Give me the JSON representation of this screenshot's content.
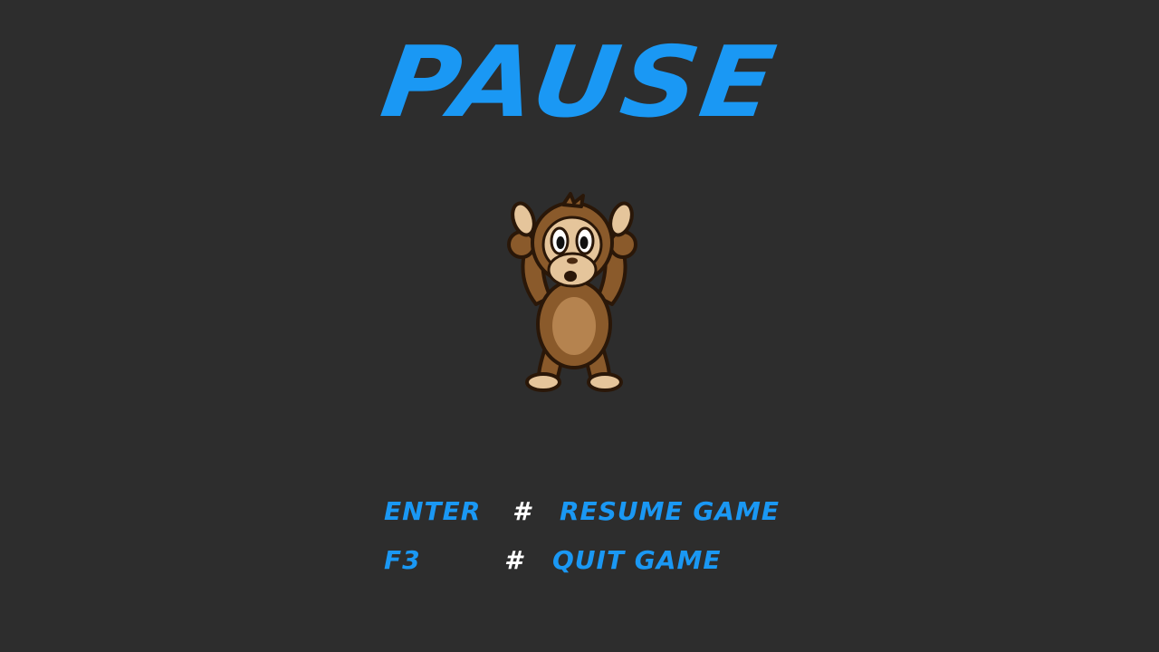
{
  "pause_menu": {
    "title": "PAUSE",
    "mascot_icon": "monkey-hands-up-icon",
    "controls": [
      {
        "key": "ENTER",
        "separator": "#",
        "action": "RESUME GAME"
      },
      {
        "key": "F3",
        "separator": "#",
        "action": "QUIT GAME"
      }
    ]
  },
  "colors": {
    "background": "#2d2d2d",
    "accent": "#1a98f4",
    "separator": "#ffffff"
  }
}
